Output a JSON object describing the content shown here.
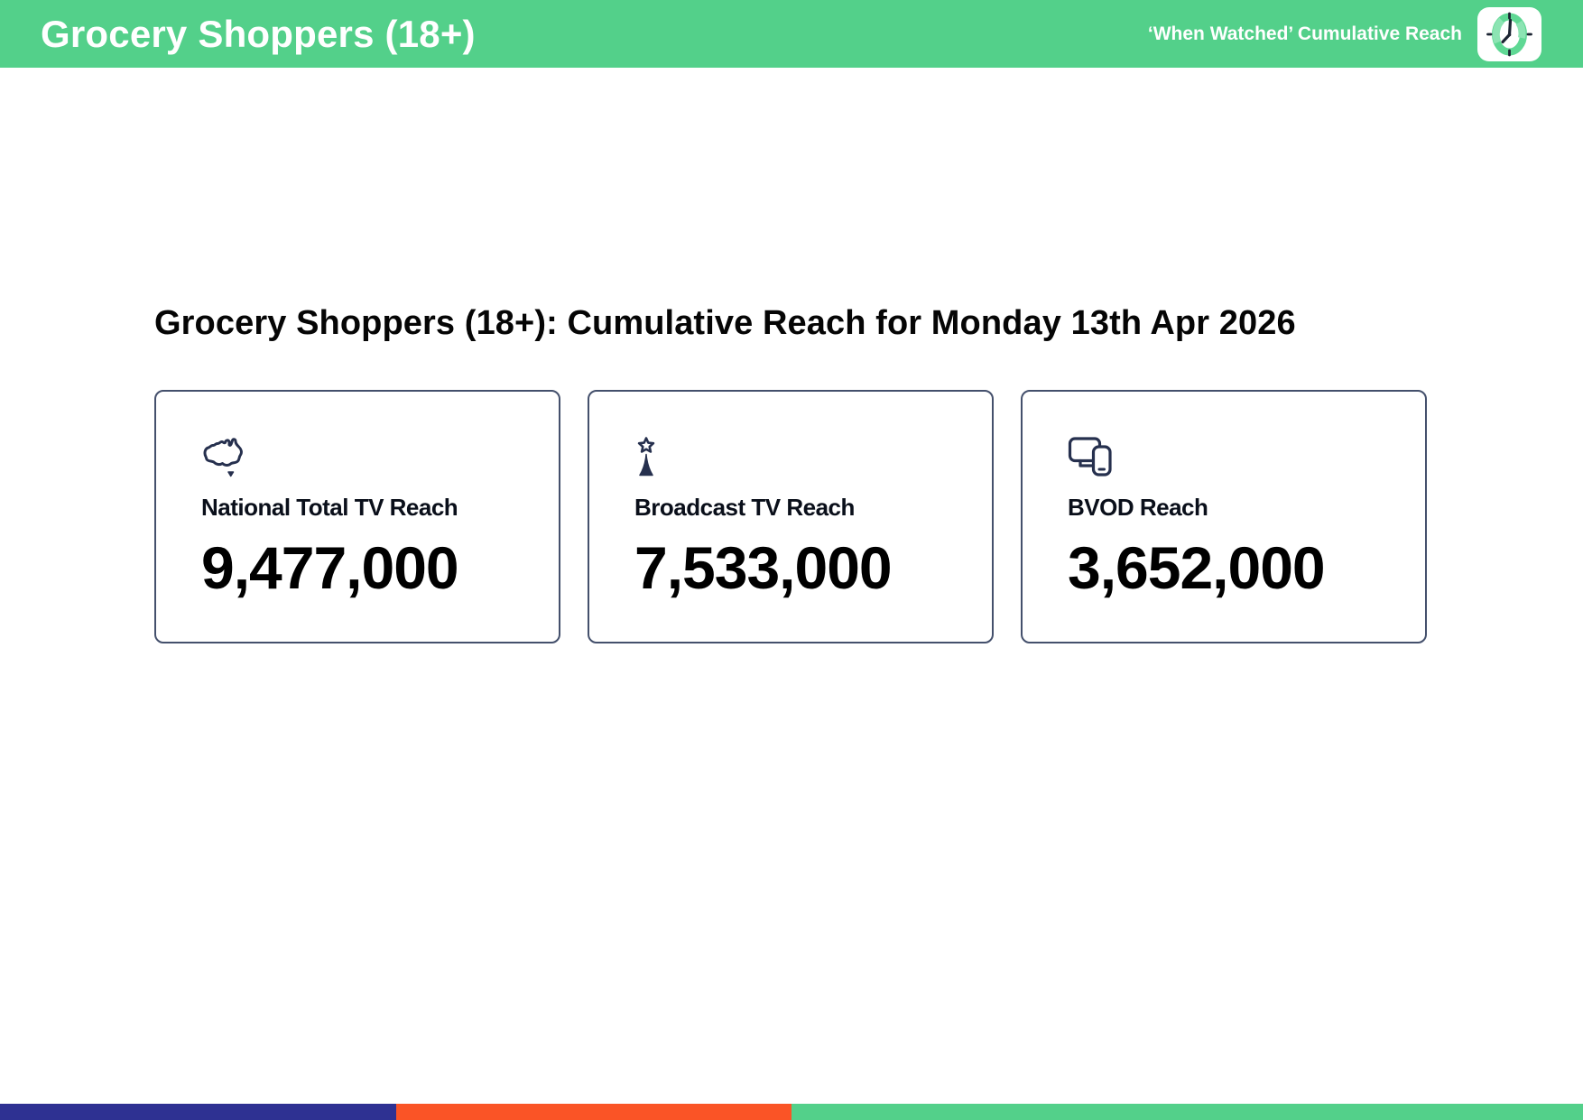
{
  "header": {
    "title": "Grocery Shoppers (18+)",
    "tagline": "‘When Watched’ Cumulative Reach",
    "logo_icon": "clock-logo-icon"
  },
  "main": {
    "heading": "Grocery Shoppers (18+): Cumulative Reach for Monday 13th Apr 2026",
    "cards": [
      {
        "icon": "australia-map-icon",
        "label": "National Total TV Reach",
        "value": "9,477,000"
      },
      {
        "icon": "broadcast-tower-icon",
        "label": "Broadcast TV Reach",
        "value": "7,533,000"
      },
      {
        "icon": "tv-and-mobile-devices-icon",
        "label": "BVOD Reach",
        "value": "3,652,000"
      }
    ]
  },
  "footer_bar": {
    "segments": [
      {
        "name": "blue",
        "color": "#2E3192",
        "width_pct": 25
      },
      {
        "name": "orange",
        "color": "#FA5426",
        "width_pct": 25
      },
      {
        "name": "green",
        "color": "#53D08A",
        "width_pct": 50
      }
    ]
  },
  "colors": {
    "brand_green": "#53D08A",
    "icon_navy": "#26304E",
    "card_border": "#44506C"
  }
}
